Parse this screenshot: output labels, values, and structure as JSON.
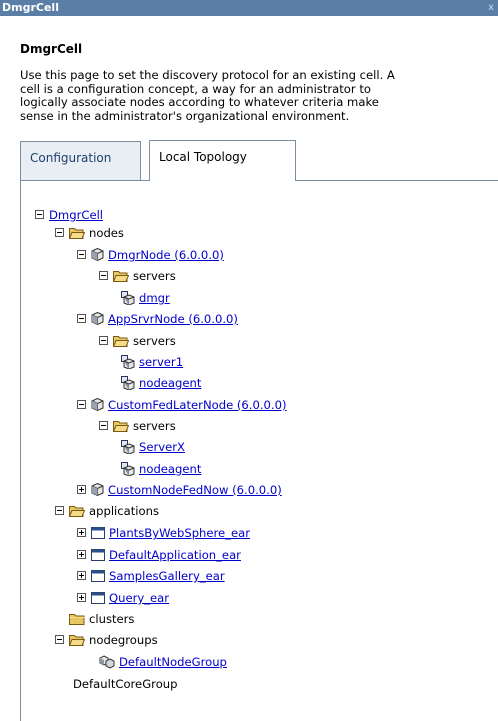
{
  "window": {
    "title": "DmgrCell",
    "close_glyph": "x"
  },
  "page": {
    "title": "DmgrCell",
    "description_lines": [
      "Use this page to set the discovery protocol for an existing cell. A",
      "cell is a configuration concept, a way for an administrator to",
      "logically associate nodes according to whatever criteria make",
      "sense in the administrator's organizational environment."
    ]
  },
  "tabs": [
    {
      "label": "Configuration",
      "active": false
    },
    {
      "label": "Local Topology",
      "active": true
    }
  ],
  "tree": {
    "cell": "DmgrCell",
    "nodes_label": "nodes",
    "servers_label": "servers",
    "dmgr_node": {
      "label": "DmgrNode (6.0.0.0)",
      "servers": [
        "dmgr"
      ]
    },
    "appsrvr_node": {
      "label": "AppSrvrNode (6.0.0.0)",
      "servers": [
        "server1",
        "nodeagent"
      ]
    },
    "customfedlater_node": {
      "label": "CustomFedLaterNode (6.0.0.0)",
      "servers": [
        "ServerX",
        "nodeagent"
      ]
    },
    "customnodefednow": {
      "label": "CustomNodeFedNow (6.0.0.0)"
    },
    "applications_label": "applications",
    "applications": [
      "PlantsByWebSphere_ear",
      "DefaultApplication_ear",
      "SamplesGallery_ear",
      "Query_ear"
    ],
    "clusters_label": "clusters",
    "nodegroups_label": "nodegroups",
    "nodegroups": [
      "DefaultNodeGroup"
    ],
    "core_group": "DefaultCoreGroup"
  },
  "colors": {
    "titlebar": "#5b7ea6",
    "link": "#0000cc",
    "border": "#7d8fa3",
    "folder": "#d9b24a"
  }
}
